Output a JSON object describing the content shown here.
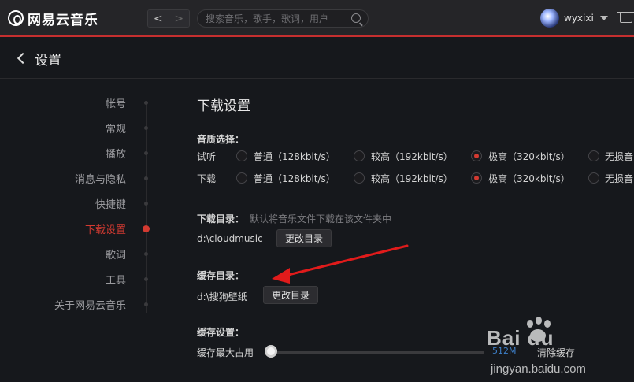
{
  "app": {
    "logo_text": "网易云音乐"
  },
  "topbar": {
    "back_glyph": "<",
    "forward_glyph": ">",
    "search_placeholder": "搜索音乐，歌手，歌词，用户",
    "username": "wyxixi"
  },
  "page": {
    "title": "设置"
  },
  "sidebar": {
    "items": [
      {
        "label": "帐号"
      },
      {
        "label": "常规"
      },
      {
        "label": "播放"
      },
      {
        "label": "消息与隐私"
      },
      {
        "label": "快捷键"
      },
      {
        "label": "下载设置",
        "active": true
      },
      {
        "label": "歌词"
      },
      {
        "label": "工具"
      },
      {
        "label": "关于网易云音乐"
      }
    ]
  },
  "download": {
    "title": "下载设置",
    "quality_label": "音质选择：",
    "rows": [
      {
        "label": "试听",
        "selected": 2
      },
      {
        "label": "下载",
        "selected": 2
      }
    ],
    "options": [
      "普通（128kbit/s）",
      "较高（192kbit/s）",
      "极高（320kbit/s）",
      "无损音"
    ],
    "dir_label": "下载目录：",
    "dir_hint": "默认将音乐文件下载在该文件夹中",
    "dir_path": "d:\\cloudmusic",
    "change_dir_button": "更改目录",
    "cache_dir_label": "缓存目录：",
    "cache_dir_path": "d:\\搜狗壁纸",
    "cache_change_button": "更改目录",
    "cache_settings_label": "缓存设置：",
    "cache_max_label": "缓存最大占用",
    "cache_value": "512M",
    "clear_cache_button": "清除缓存"
  },
  "watermark": {
    "logo": "Bai du",
    "text": "jingyan.baidu.com"
  },
  "colors": {
    "accent": "#d33a31",
    "topbar": "#252528",
    "background": "#16181c"
  }
}
